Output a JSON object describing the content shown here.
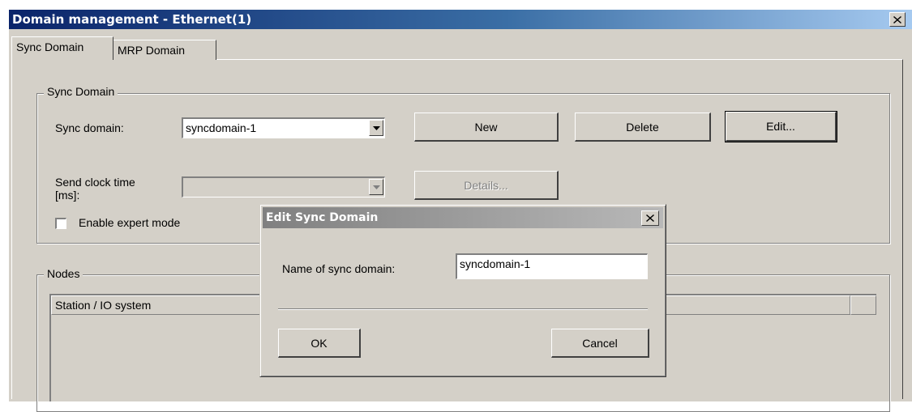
{
  "window": {
    "title": "Domain management - Ethernet(1)",
    "close_glyph": "✕"
  },
  "tabs": [
    {
      "label": "Sync Domain",
      "active": true
    },
    {
      "label": "MRP Domain",
      "active": false
    }
  ],
  "sync_group": {
    "title": "Sync Domain",
    "sync_domain_label": "Sync domain:",
    "sync_domain_value": "syncdomain-1",
    "new_label": "New",
    "delete_label": "Delete",
    "edit_label": "Edit...",
    "send_clock_label_line1": "Send clock time",
    "send_clock_label_line2": "[ms]:",
    "send_clock_value": "",
    "details_label": "Details...",
    "expert_mode_label": "Enable expert mode",
    "expert_mode_checked": false
  },
  "nodes_group": {
    "title": "Nodes",
    "columns": [
      "Station / IO system",
      ""
    ]
  },
  "dialog": {
    "title": "Edit Sync Domain",
    "close_glyph": "✕",
    "name_label": "Name of sync domain:",
    "name_value": "syncdomain-1",
    "ok_label": "OK",
    "cancel_label": "Cancel"
  }
}
